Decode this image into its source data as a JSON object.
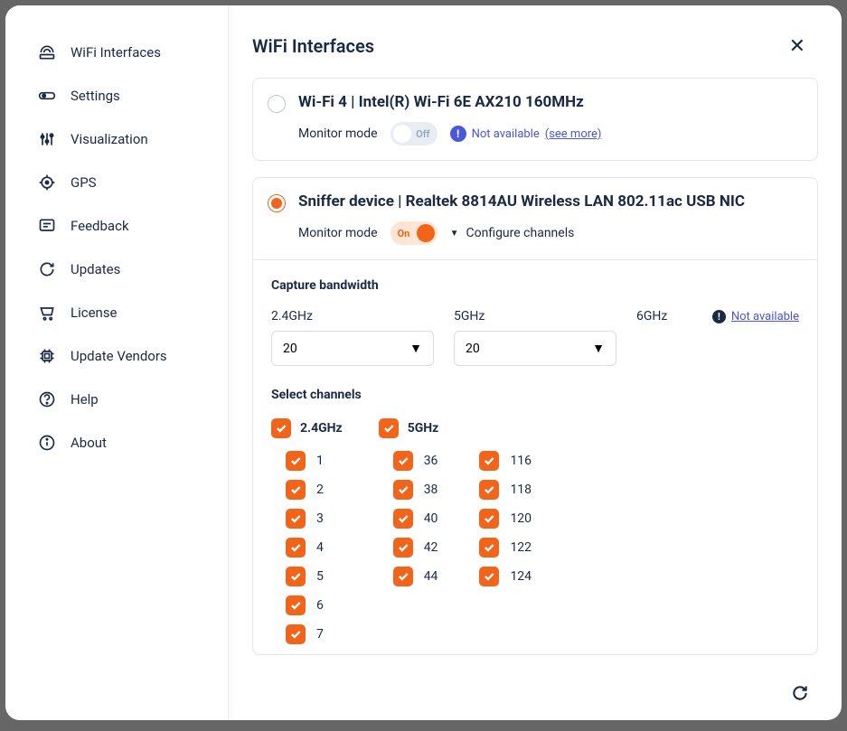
{
  "sidebar": {
    "items": [
      {
        "label": "WiFi Interfaces",
        "icon": "wifi"
      },
      {
        "label": "Settings",
        "icon": "toggle"
      },
      {
        "label": "Visualization",
        "icon": "sliders"
      },
      {
        "label": "GPS",
        "icon": "gps"
      },
      {
        "label": "Feedback",
        "icon": "feedback"
      },
      {
        "label": "Updates",
        "icon": "refresh"
      },
      {
        "label": "License",
        "icon": "cart"
      },
      {
        "label": "Update Vendors",
        "icon": "chip"
      },
      {
        "label": "Help",
        "icon": "help"
      },
      {
        "label": "About",
        "icon": "info"
      }
    ]
  },
  "header": {
    "title": "WiFi Interfaces"
  },
  "interfaces": [
    {
      "title": "Wi-Fi 4 | Intel(R) Wi-Fi 6E AX210 160MHz",
      "monitor_label": "Monitor mode",
      "toggle_state": "Off",
      "not_avail": "Not available",
      "see_more": "(see more)",
      "selected": false
    },
    {
      "title": "Sniffer device | Realtek 8814AU Wireless LAN 802.11ac USB NIC",
      "monitor_label": "Monitor mode",
      "toggle_state": "On",
      "configure": "Configure channels",
      "selected": true
    }
  ],
  "capture": {
    "title": "Capture bandwidth",
    "bands": {
      "b24": {
        "label": "2.4GHz",
        "value": "20"
      },
      "b5": {
        "label": "5GHz",
        "value": "20"
      },
      "b6": {
        "label": "6GHz",
        "not_avail": "Not available"
      }
    }
  },
  "channels": {
    "title": "Select channels",
    "band24": {
      "label": "2.4GHz",
      "items": [
        "1",
        "2",
        "3",
        "4",
        "5",
        "6",
        "7"
      ]
    },
    "band5": {
      "label": "5GHz",
      "col1": [
        "36",
        "38",
        "40",
        "42",
        "44"
      ],
      "col2": [
        "116",
        "118",
        "120",
        "122",
        "124"
      ]
    }
  }
}
